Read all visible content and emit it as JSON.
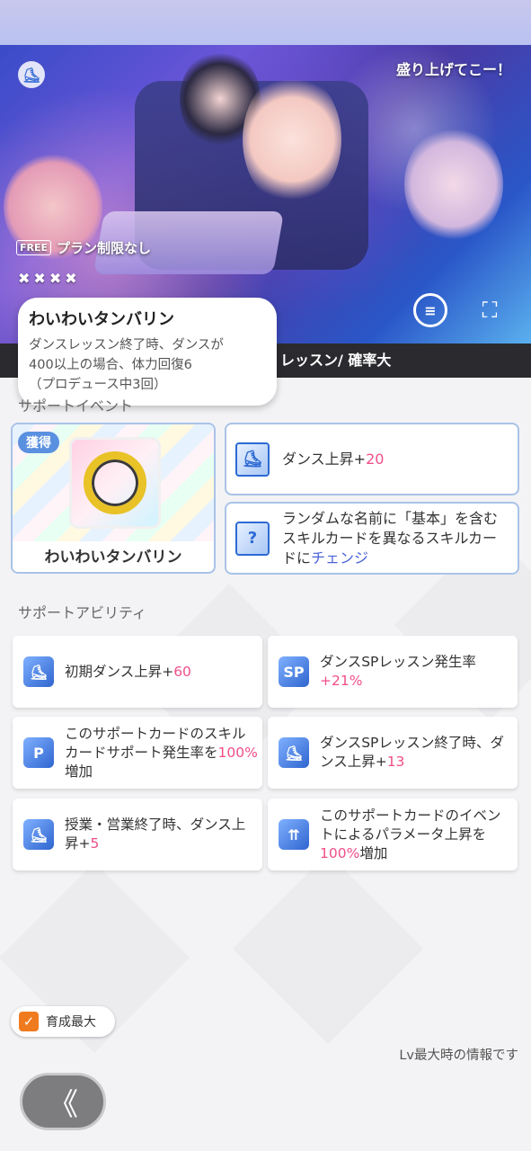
{
  "hero": {
    "caption": "盛り上げてこー！",
    "free_badge": "FREE",
    "plan_text": "プラン制限なし",
    "stars": [
      "✖",
      "✖",
      "✖",
      "✖"
    ]
  },
  "tooltip": {
    "title": "わいわいタンバリン",
    "lines": [
      "ダンスレッスン終了時、ダンスが",
      "400以上の場合、体力回復6",
      "（プロデュース中3回）"
    ]
  },
  "skill_bar": {
    "text": "レッスン/ 確率大"
  },
  "support_event": {
    "section_label": "サポートイベント",
    "got_badge": "獲得",
    "item_name": "わいわいタンバリン",
    "dance_up_label": "ダンス上昇+",
    "dance_up_value": "20",
    "change_text": "ランダムな名前に「基本」を含むスキルカードを異なるスキルカードに",
    "change_highlight": "チェンジ"
  },
  "abilities": {
    "section_label": "サポートアビリティ",
    "items": [
      {
        "icon": "dance-shoe-icon",
        "text": "初期ダンス上昇+",
        "value": "60"
      },
      {
        "icon": "sp-icon",
        "icon_text": "SP",
        "text": "ダンスSPレッスン発生率",
        "value": "+21%"
      },
      {
        "icon": "p-sparkle-icon",
        "icon_text": "P",
        "text": "このサポートカードのスキルカードサポート発生率を",
        "value": "100%",
        "suffix": "増加"
      },
      {
        "icon": "dance-shoe-icon",
        "text": "ダンスSPレッスン終了時、ダンス上昇+",
        "value": "13"
      },
      {
        "icon": "dance-shoe-icon",
        "text": "授業・営業終了時、ダンス上昇+",
        "value": "5"
      },
      {
        "icon": "param-up-icon",
        "text": "このサポートカードのイベントによるパラメータ上昇を",
        "value": "100%",
        "suffix": "増加"
      }
    ]
  },
  "footer": {
    "grow_max_label": "育成最大",
    "grow_max_checked": true,
    "lv_note": "Lv最大時の情報です",
    "back_symbol": "《"
  },
  "colors": {
    "accent_pink": "#f04e8a",
    "accent_blue": "#4a63d8",
    "card_border": "#a9c3e8",
    "check_orange": "#f07a1e"
  }
}
